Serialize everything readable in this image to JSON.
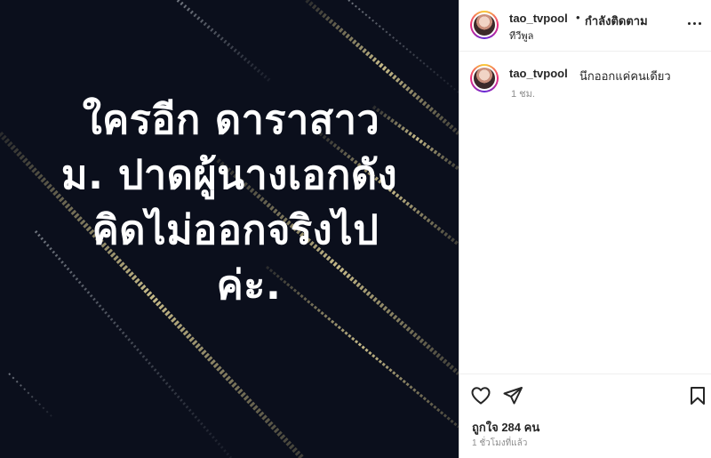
{
  "post_image": {
    "lines": [
      "ใครอีก ดาราสาว",
      "ม. ปาดผู้นางเอกดัง",
      "คิดไม่ออกจริงไป",
      "ค่ะ."
    ],
    "background_color": "#0b0f1c",
    "text_color": "#ffffff"
  },
  "header": {
    "username": "tao_tvpool",
    "separator": "•",
    "follow_status": "กำลังติดตาม",
    "location": "ทีวีพูล",
    "more_icon": "more-horizontal-icon"
  },
  "caption": {
    "username": "tao_tvpool",
    "text": "นึกออกแค่คนเดียว",
    "time": "1 ชม."
  },
  "actions": {
    "like_icon": "heart-icon",
    "share_icon": "paper-plane-icon",
    "save_icon": "bookmark-icon",
    "likes_text": "ถูกใจ 284 คน",
    "post_time": "1 ชั่วโมงที่แล้ว"
  },
  "colors": {
    "text_primary": "#262626",
    "text_secondary": "#8e8e8e",
    "border": "#dbdbdb"
  }
}
